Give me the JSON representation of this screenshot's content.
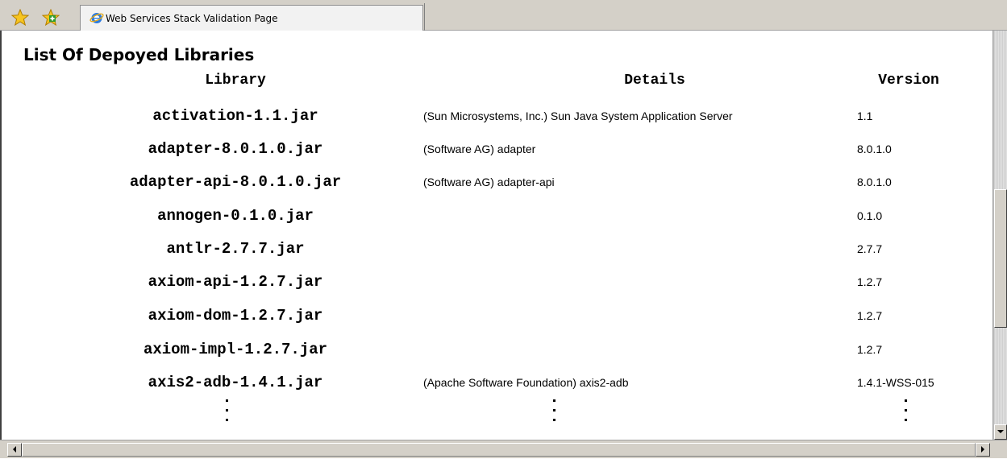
{
  "browser": {
    "tab_title": "Web Services Stack Validation Page",
    "favorites_icon": "favorites-star-icon",
    "add_favorites_icon": "add-to-favorites-icon",
    "tab_icon": "internet-explorer-icon"
  },
  "page": {
    "heading": "List Of Depoyed Libraries",
    "table": {
      "headers": {
        "library": "Library",
        "details": "Details",
        "version": "Version"
      },
      "rows": [
        {
          "library": "activation-1.1.jar",
          "details": "(Sun Microsystems, Inc.) Sun Java System Application Server",
          "version": "1.1"
        },
        {
          "library": "adapter-8.0.1.0.jar",
          "details": "(Software AG) adapter",
          "version": "8.0.1.0"
        },
        {
          "library": "adapter-api-8.0.1.0.jar",
          "details": "(Software AG) adapter-api",
          "version": "8.0.1.0"
        },
        {
          "library": "annogen-0.1.0.jar",
          "details": "",
          "version": "0.1.0"
        },
        {
          "library": "antlr-2.7.7.jar",
          "details": "",
          "version": "2.7.7"
        },
        {
          "library": "axiom-api-1.2.7.jar",
          "details": "",
          "version": "1.2.7"
        },
        {
          "library": "axiom-dom-1.2.7.jar",
          "details": "",
          "version": "1.2.7"
        },
        {
          "library": "axiom-impl-1.2.7.jar",
          "details": "",
          "version": "1.2.7"
        },
        {
          "library": "axis2-adb-1.4.1.jar",
          "details": "(Apache Software Foundation) axis2-adb",
          "version": "1.4.1-WSS-015"
        }
      ]
    }
  },
  "scrollbars": {
    "left_arrow_icon": "scroll-left-arrow-icon",
    "right_arrow_icon": "scroll-right-arrow-icon",
    "down_arrow_icon": "scroll-down-arrow-icon"
  }
}
